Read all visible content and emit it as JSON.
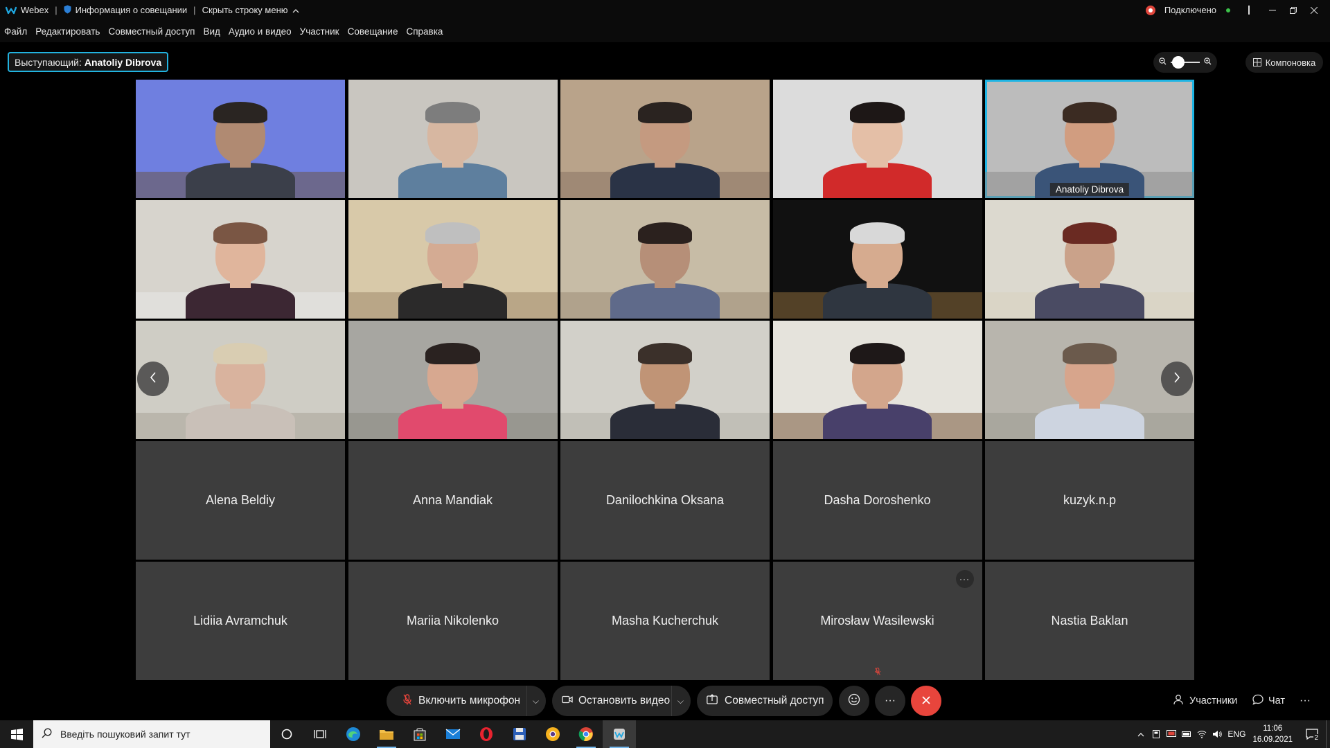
{
  "titlebar": {
    "app_name": "Webex",
    "meeting_info": "Информация о совещании",
    "hide_menu": "Скрыть строку меню",
    "status": "Подключено"
  },
  "menu": [
    "Файл",
    "Редактировать",
    "Совместный доступ",
    "Вид",
    "Аудио и видео",
    "Участник",
    "Совещание",
    "Справка"
  ],
  "speaker": {
    "label": "Выступающий:",
    "name": "Anatoliy Dibrova"
  },
  "layout_button": "Компоновка",
  "video_tiles": [
    {
      "name": "",
      "bg": "#6f7fe0",
      "skin": "#b08a72",
      "shirt": "#3b3f4a",
      "hair": "#2a2522",
      "floor": "#6a5548"
    },
    {
      "name": "",
      "bg": "#c9c6c0",
      "skin": "#d7b7a1",
      "shirt": "#5e7f9e",
      "hair": "#7d7d7d",
      "floor": "#c9c6c0"
    },
    {
      "name": "",
      "bg": "#b9a38a",
      "skin": "#c49a80",
      "shirt": "#2a3346",
      "hair": "#2a2320",
      "floor": "#8a7564"
    },
    {
      "name": "",
      "bg": "#dcdcdc",
      "skin": "#e4bfa7",
      "shirt": "#d12a2a",
      "hair": "#1d1716",
      "floor": "#dcdcdc"
    },
    {
      "name": "Anatoliy Dibrova",
      "bg": "#bcbcbc",
      "skin": "#d19d80",
      "shirt": "#3a5478",
      "hair": "#3b2b22",
      "floor": "#8c8c8c"
    },
    {
      "name": "",
      "bg": "#d7d4cd",
      "skin": "#e0b59c",
      "shirt": "#3c2733",
      "hair": "#7a5644",
      "floor": "#e8e8e8"
    },
    {
      "name": "",
      "bg": "#d8c9a9",
      "skin": "#d4ab93",
      "shirt": "#2b2a2a",
      "hair": "#bfbfbf",
      "floor": "#a0886c"
    },
    {
      "name": "",
      "bg": "#c7bca6",
      "skin": "#b68f78",
      "shirt": "#5f6a8a",
      "hair": "#2b211e",
      "floor": "#9c8d76"
    },
    {
      "name": "",
      "bg": "#111111",
      "skin": "#d6ab8f",
      "shirt": "#2f3640",
      "hair": "#d8d8d8",
      "floor": "#8a6a3a"
    },
    {
      "name": "",
      "bg": "#dcd9cf",
      "skin": "#caa28a",
      "shirt": "#4a4b63",
      "hair": "#6a2a22",
      "floor": "#d8d2c0"
    },
    {
      "name": "",
      "bg": "#cfcdc5",
      "skin": "#d9b39e",
      "shirt": "#c9c0b8",
      "hair": "#d9cdb2",
      "floor": "#a9a497"
    },
    {
      "name": "",
      "bg": "#a7a6a1",
      "skin": "#d7a890",
      "shirt": "#e14a6d",
      "hair": "#2a2220",
      "floor": "#8d8b84"
    },
    {
      "name": "",
      "bg": "#d2d0c9",
      "skin": "#c09476",
      "shirt": "#2a2d38",
      "hair": "#3b302a",
      "floor": "#b2b0a8"
    },
    {
      "name": "",
      "bg": "#e5e3dc",
      "skin": "#d3a68c",
      "shirt": "#48406a",
      "hair": "#1e1818",
      "floor": "#7a5a3d"
    },
    {
      "name": "",
      "bg": "#b8b5ad",
      "skin": "#d7a58c",
      "shirt": "#cdd4e0",
      "hair": "#6b5a4c",
      "floor": "#9d9a92"
    }
  ],
  "name_tiles": [
    "Alena Beldiy",
    "Anna Mandiak",
    "Danilochkina Oksana",
    "Dasha Doroshenko",
    "kuzyk.n.p",
    "Lidiia Avramchuk",
    "Mariia Nikolenko",
    "Masha Kucherchuk",
    "Mirosław Wasilewski",
    "Nastia Baklan"
  ],
  "controls": {
    "mic": "Включить микрофон",
    "video": "Остановить видео",
    "share": "Совместный доступ",
    "participants": "Участники",
    "chat": "Чат"
  },
  "taskbar": {
    "search_placeholder": "Введіть пошуковий запит тут",
    "lang": "ENG",
    "time": "11:06",
    "date": "16.09.2021",
    "notif_count": "2"
  },
  "colors": {
    "accent": "#1fb5e4",
    "end_call": "#e8453c",
    "recording": "#e0463c",
    "connected": "#3cc24a"
  }
}
